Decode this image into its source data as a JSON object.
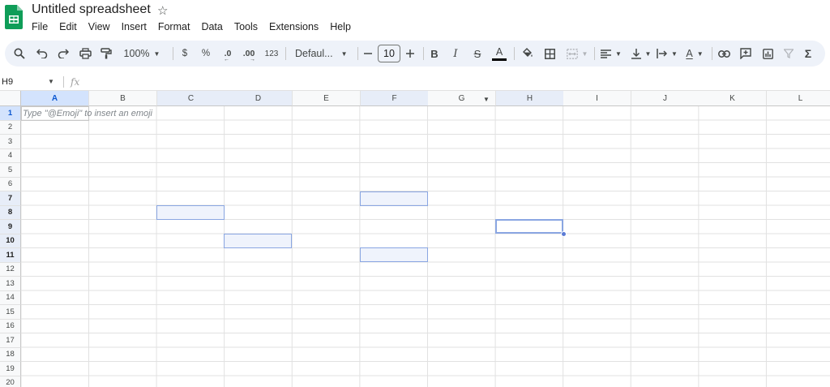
{
  "app": {
    "doc_title": "Untitled spreadsheet",
    "star_icon": "star-outline-icon",
    "logo_icon": "sheets-logo-icon",
    "brand_color": "#0f9d58"
  },
  "menu": [
    "File",
    "Edit",
    "View",
    "Insert",
    "Format",
    "Data",
    "Tools",
    "Extensions",
    "Help"
  ],
  "toolbar": {
    "zoom": "100%",
    "currency_label": "$",
    "percent_label": "%",
    "decrease_decimal_label": ".0",
    "increase_decimal_label": ".00",
    "more_formats_label": "123",
    "font_family": "Defaul...",
    "font_size": "10",
    "bold_label": "B",
    "italic_label": "I",
    "strikethrough_label": "S",
    "text_color_label": "A",
    "text_rotation_label": "A",
    "sum_label": "Σ",
    "accent_color": "#0b57d0",
    "toolbar_bg": "#eef2f9"
  },
  "formula_bar": {
    "cell_ref": "H9",
    "fx_label": "fx",
    "value": ""
  },
  "grid": {
    "columns": [
      "A",
      "B",
      "C",
      "D",
      "E",
      "F",
      "G",
      "H",
      "I",
      "J",
      "K",
      "L"
    ],
    "rows": [
      "1",
      "2",
      "3",
      "4",
      "5",
      "6",
      "7",
      "8",
      "9",
      "10",
      "11",
      "12",
      "13",
      "14",
      "15",
      "16",
      "17",
      "18",
      "19",
      "20"
    ],
    "active_cell": "H9",
    "selected_cells": [
      "F7",
      "C8",
      "H9",
      "D10",
      "F11"
    ],
    "emoji_hint": "Type \"@Emoji\" to insert an emoji",
    "selection_color": "#d3e3fd"
  }
}
